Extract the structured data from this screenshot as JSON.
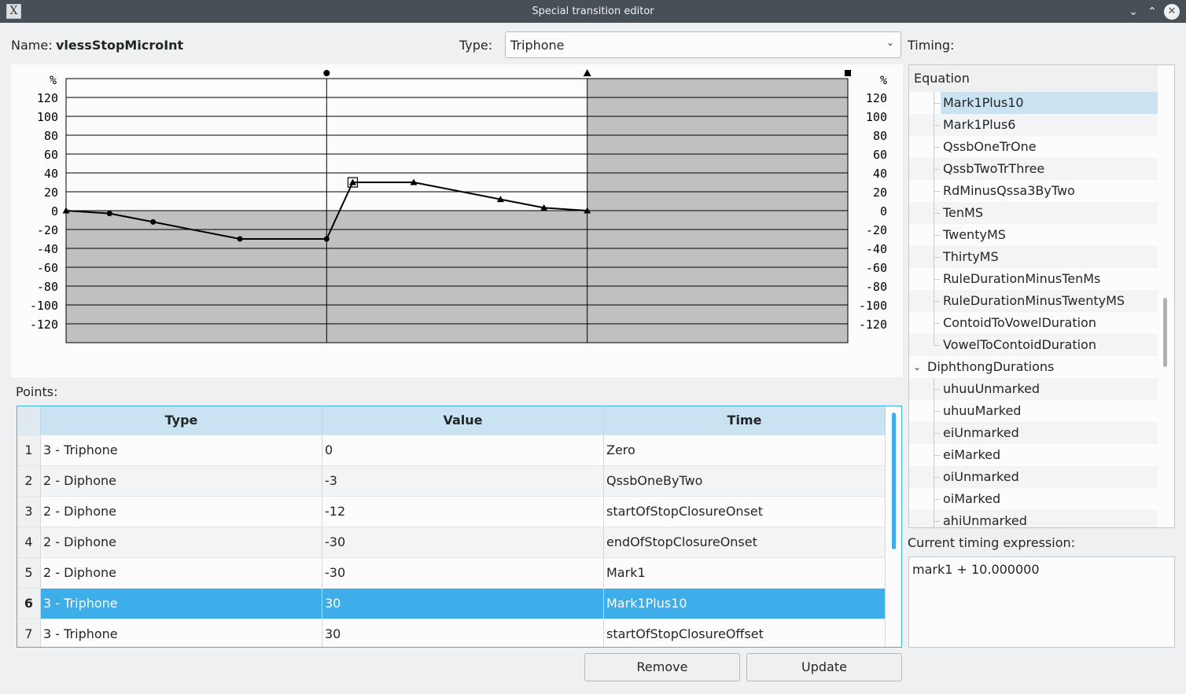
{
  "window": {
    "title": "Special transition editor",
    "app_icon": "X"
  },
  "header": {
    "name_label": "Name:",
    "name_value": "vlessStopMicroInt",
    "type_label": "Type:",
    "type_value": "Triphone",
    "timing_label": "Timing:"
  },
  "chart_data": {
    "type": "line",
    "ylabel": "%",
    "yticks": [
      120,
      100,
      80,
      60,
      40,
      20,
      0,
      -20,
      -40,
      -60,
      -80,
      -100,
      -120
    ],
    "ylim": [
      -140,
      140
    ],
    "xlim": [
      0,
      3
    ],
    "region_markers": [
      "circle",
      "triangle",
      "square"
    ],
    "points": [
      {
        "x": 0.0,
        "y": 0,
        "marker": "triangle"
      },
      {
        "x": 0.167,
        "y": -3,
        "marker": "circle"
      },
      {
        "x": 0.334,
        "y": -12,
        "marker": "circle"
      },
      {
        "x": 0.667,
        "y": -30,
        "marker": "circle"
      },
      {
        "x": 1.0,
        "y": -30,
        "marker": "circle"
      },
      {
        "x": 1.1,
        "y": 30,
        "marker": "triangle",
        "selected": true
      },
      {
        "x": 1.334,
        "y": 30,
        "marker": "triangle"
      },
      {
        "x": 1.667,
        "y": 12,
        "marker": "triangle"
      },
      {
        "x": 1.834,
        "y": 3,
        "marker": "triangle"
      },
      {
        "x": 2.0,
        "y": 0,
        "marker": "triangle"
      }
    ]
  },
  "points": {
    "label": "Points:",
    "columns": [
      "Type",
      "Value",
      "Time"
    ],
    "rows": [
      {
        "n": "1",
        "type": "3 - Triphone",
        "value": "0",
        "time": "Zero"
      },
      {
        "n": "2",
        "type": "2 - Diphone",
        "value": "-3",
        "time": "QssbOneByTwo"
      },
      {
        "n": "3",
        "type": "2 - Diphone",
        "value": "-12",
        "time": "startOfStopClosureOnset"
      },
      {
        "n": "4",
        "type": "2 - Diphone",
        "value": "-30",
        "time": "endOfStopClosureOnset"
      },
      {
        "n": "5",
        "type": "2 - Diphone",
        "value": "-30",
        "time": "Mark1"
      },
      {
        "n": "6",
        "type": "3 - Triphone",
        "value": "30",
        "time": "Mark1Plus10"
      },
      {
        "n": "7",
        "type": "3 - Triphone",
        "value": "30",
        "time": "startOfStopClosureOffset"
      }
    ],
    "selected_row": "6"
  },
  "buttons": {
    "remove": "Remove",
    "update": "Update"
  },
  "timing_tree": {
    "header": "Equation",
    "items": [
      "Mark1Plus10",
      "Mark1Plus6",
      "QssbOneTrOne",
      "QssbTwoTrThree",
      "RdMinusQssa3ByTwo",
      "TenMS",
      "TwentyMS",
      "ThirtyMS",
      "RuleDurationMinusTenMs",
      "RuleDurationMinusTwentyMS",
      "ContoidToVowelDuration",
      "VowelToContoidDuration"
    ],
    "group": "DiphthongDurations",
    "group_items": [
      "uhuuUnmarked",
      "uhuuMarked",
      "eiUnmarked",
      "eiMarked",
      "oiUnmarked",
      "oiMarked",
      "ahiUnmarked"
    ],
    "selected": "Mark1Plus10"
  },
  "expression": {
    "label": "Current timing expression:",
    "value": "mark1 + 10.000000"
  },
  "colors": {
    "accent": "#3daee9",
    "selection_light": "#c9e3f3",
    "chart_fill": "#c0c0c0"
  }
}
